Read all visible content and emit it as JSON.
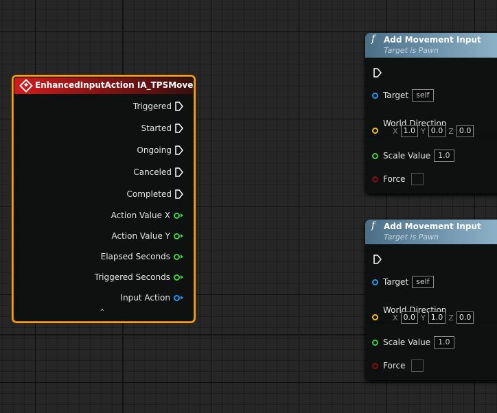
{
  "event_node": {
    "title": "EnhancedInputAction IA_TPSMove",
    "exec_pins": [
      "Triggered",
      "Started",
      "Ongoing",
      "Canceled",
      "Completed"
    ],
    "value_pins": [
      {
        "label": "Action Value X",
        "type": "float"
      },
      {
        "label": "Action Value Y",
        "type": "float"
      },
      {
        "label": "Elapsed Seconds",
        "type": "float"
      },
      {
        "label": "Triggered Seconds",
        "type": "float"
      },
      {
        "label": "Input Action",
        "type": "object"
      }
    ]
  },
  "functions": [
    {
      "icon": "f",
      "title": "Add Movement Input",
      "subtitle": "Target is Pawn",
      "target_label": "Target",
      "target_value": "self",
      "direction_label": "World Direction",
      "x_label": "X",
      "x": "1.0",
      "y_label": "Y",
      "y": "0.0",
      "z_label": "Z",
      "z": "0.0",
      "scale_label": "Scale Value",
      "scale": "1.0",
      "force_label": "Force",
      "force_checked": false
    },
    {
      "icon": "f",
      "title": "Add Movement Input",
      "subtitle": "Target is Pawn",
      "target_label": "Target",
      "target_value": "self",
      "direction_label": "World Direction",
      "x_label": "X",
      "x": "0.0",
      "y_label": "Y",
      "y": "1.0",
      "z_label": "Z",
      "z": "0.0",
      "scale_label": "Scale Value",
      "scale": "1.0",
      "force_label": "Force",
      "force_checked": false
    }
  ],
  "colors": {
    "event_border": "#f7a312",
    "event_header": "#d21c1c",
    "function_header": "#6d93ab",
    "float_pin": "#3ed23e",
    "object_pin": "#1e9ae6",
    "vector_pin": "#f0c010",
    "bool_pin": "#8c0e0e",
    "exec_pin": "#ffffff"
  }
}
